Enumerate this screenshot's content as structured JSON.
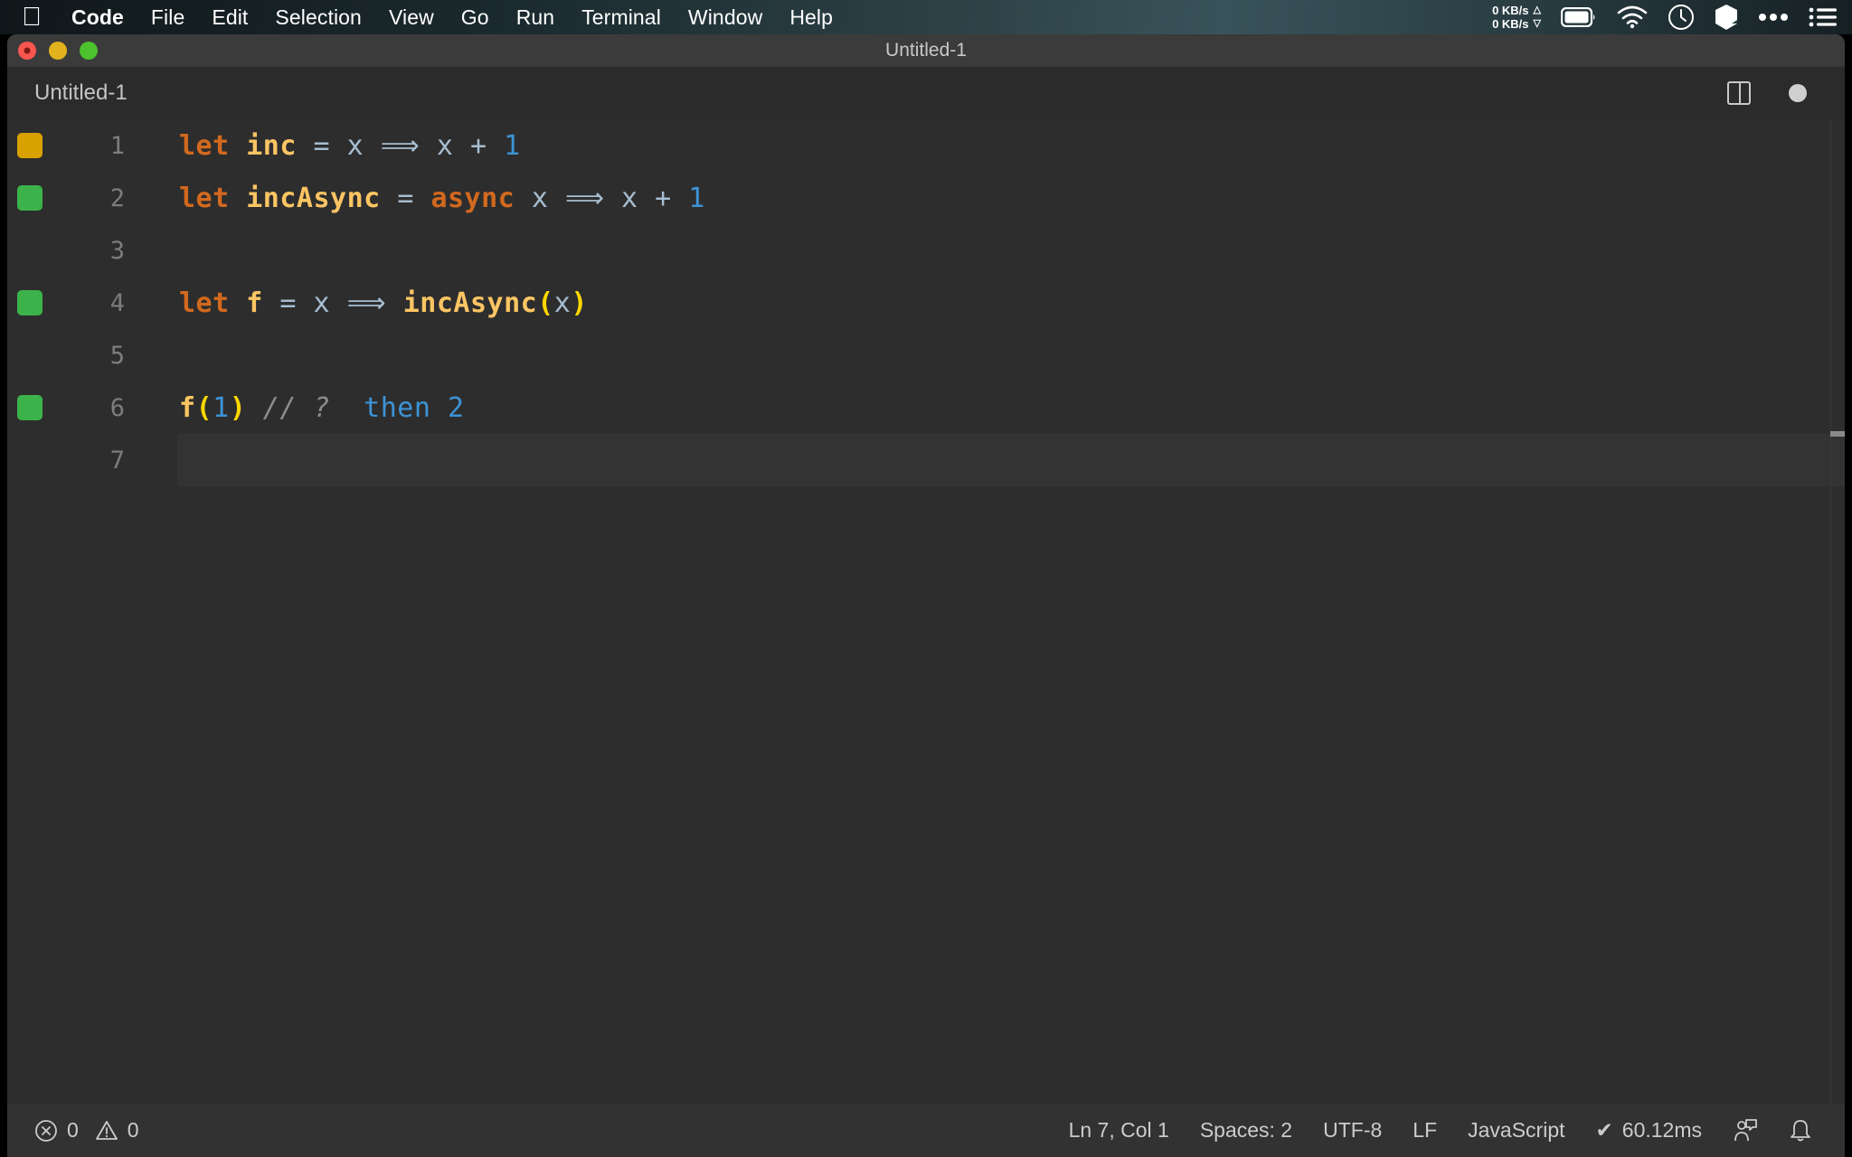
{
  "menubar": {
    "apple_icon": "apple-logo",
    "items": [
      {
        "label": "Code",
        "bold": true
      },
      {
        "label": "File",
        "bold": false
      },
      {
        "label": "Edit",
        "bold": false
      },
      {
        "label": "Selection",
        "bold": false
      },
      {
        "label": "View",
        "bold": false
      },
      {
        "label": "Go",
        "bold": false
      },
      {
        "label": "Run",
        "bold": false
      },
      {
        "label": "Terminal",
        "bold": false
      },
      {
        "label": "Window",
        "bold": false
      },
      {
        "label": "Help",
        "bold": false
      }
    ],
    "network": {
      "upload": "0 KB/s",
      "download": "0 KB/s",
      "up_arrow": "△",
      "down_arrow": "▽"
    },
    "status_icons": [
      "battery-icon",
      "wifi-icon",
      "clock-icon",
      "cube-icon",
      "ellipsis-icon",
      "control-center-icon"
    ]
  },
  "window": {
    "title": "Untitled-1",
    "traffic_lights": [
      "close-button",
      "minimize-button",
      "maximize-button"
    ]
  },
  "tabbar": {
    "tabs": [
      {
        "label": "Untitled-1",
        "active": true,
        "dirty": true
      }
    ],
    "actions": [
      "split-editor-icon",
      "unsaved-indicator-dot"
    ]
  },
  "editor": {
    "lines": [
      {
        "number": "1",
        "marker": "orange",
        "current": false,
        "tokens": [
          {
            "t": "let ",
            "c": "tok-kw"
          },
          {
            "t": "inc ",
            "c": "tok-fn"
          },
          {
            "t": "= ",
            "c": "tok-op"
          },
          {
            "t": "x ",
            "c": "tok-var"
          },
          {
            "t": "⟹ ",
            "c": "tok-op"
          },
          {
            "t": "x ",
            "c": "tok-var"
          },
          {
            "t": "+ ",
            "c": "tok-op"
          },
          {
            "t": "1",
            "c": "tok-num"
          }
        ]
      },
      {
        "number": "2",
        "marker": "green",
        "current": false,
        "tokens": [
          {
            "t": "let ",
            "c": "tok-kw"
          },
          {
            "t": "incAsync ",
            "c": "tok-fn"
          },
          {
            "t": "= ",
            "c": "tok-op"
          },
          {
            "t": "async ",
            "c": "tok-kw"
          },
          {
            "t": "x ",
            "c": "tok-var"
          },
          {
            "t": "⟹ ",
            "c": "tok-op"
          },
          {
            "t": "x ",
            "c": "tok-var"
          },
          {
            "t": "+ ",
            "c": "tok-op"
          },
          {
            "t": "1",
            "c": "tok-num"
          }
        ]
      },
      {
        "number": "3",
        "marker": "none",
        "current": false,
        "tokens": []
      },
      {
        "number": "4",
        "marker": "green",
        "current": false,
        "tokens": [
          {
            "t": "let ",
            "c": "tok-kw"
          },
          {
            "t": "f ",
            "c": "tok-fn"
          },
          {
            "t": "= ",
            "c": "tok-op"
          },
          {
            "t": "x ",
            "c": "tok-var"
          },
          {
            "t": "⟹ ",
            "c": "tok-op"
          },
          {
            "t": "incAsync",
            "c": "tok-fn"
          },
          {
            "t": "(",
            "c": "tok-paren"
          },
          {
            "t": "x",
            "c": "tok-var"
          },
          {
            "t": ")",
            "c": "tok-paren"
          }
        ]
      },
      {
        "number": "5",
        "marker": "none",
        "current": false,
        "tokens": []
      },
      {
        "number": "6",
        "marker": "green",
        "current": false,
        "tokens": [
          {
            "t": "f",
            "c": "tok-fn"
          },
          {
            "t": "(",
            "c": "tok-paren"
          },
          {
            "t": "1",
            "c": "tok-num"
          },
          {
            "t": ")",
            "c": "tok-paren"
          },
          {
            "t": " // ?",
            "c": "tok-cmt"
          },
          {
            "t": "  then ",
            "c": "tok-res"
          },
          {
            "t": "2",
            "c": "tok-res"
          }
        ]
      },
      {
        "number": "7",
        "marker": "none",
        "current": true,
        "tokens": []
      }
    ]
  },
  "statusbar": {
    "errors": "0",
    "warnings": "0",
    "position": "Ln 7, Col 1",
    "indentation": "Spaces: 2",
    "encoding": "UTF-8",
    "eol": "LF",
    "language": "JavaScript",
    "timing": "60.12ms",
    "timing_check": "✔",
    "right_icons": [
      "feedback-icon",
      "notifications-bell-icon"
    ]
  }
}
